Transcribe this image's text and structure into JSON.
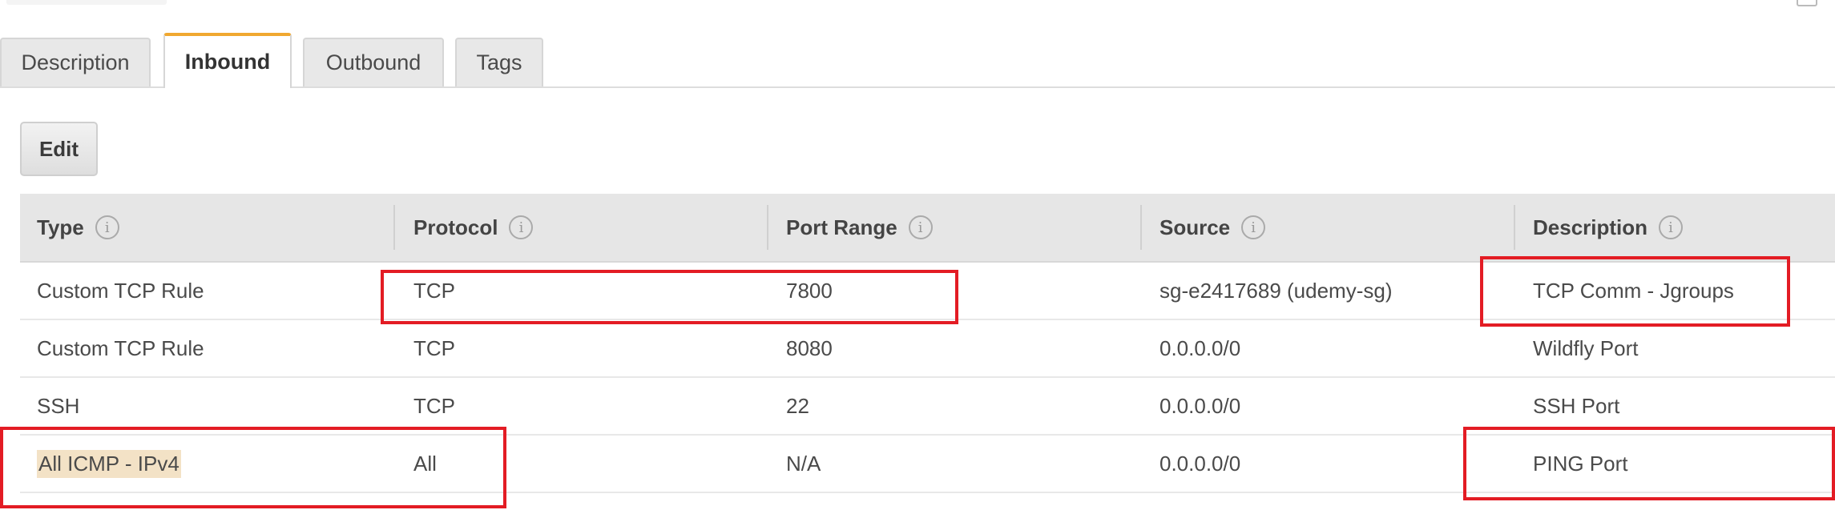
{
  "tabs": [
    {
      "label": "Description",
      "active": false
    },
    {
      "label": "Inbound",
      "active": true
    },
    {
      "label": "Outbound",
      "active": false
    },
    {
      "label": "Tags",
      "active": false
    }
  ],
  "toolbar": {
    "edit_label": "Edit"
  },
  "table": {
    "columns": [
      "Type",
      "Protocol",
      "Port Range",
      "Source",
      "Description"
    ],
    "rows": [
      [
        "Custom TCP Rule",
        "TCP",
        "7800",
        "sg-e2417689 (udemy-sg)",
        "TCP Comm - Jgroups"
      ],
      [
        "Custom TCP Rule",
        "TCP",
        "8080",
        "0.0.0.0/0",
        "Wildfly Port"
      ],
      [
        "SSH",
        "TCP",
        "22",
        "0.0.0.0/0",
        "SSH Port"
      ],
      [
        "All ICMP - IPv4",
        "All",
        "N/A",
        "0.0.0.0/0",
        "PING Port"
      ]
    ]
  },
  "icons": {
    "column_info": "info-icon"
  },
  "colors": {
    "active_tab_accent": "#f0a830",
    "annotation_red": "#e31c24",
    "selection_highlight": "#f3e2c6"
  }
}
